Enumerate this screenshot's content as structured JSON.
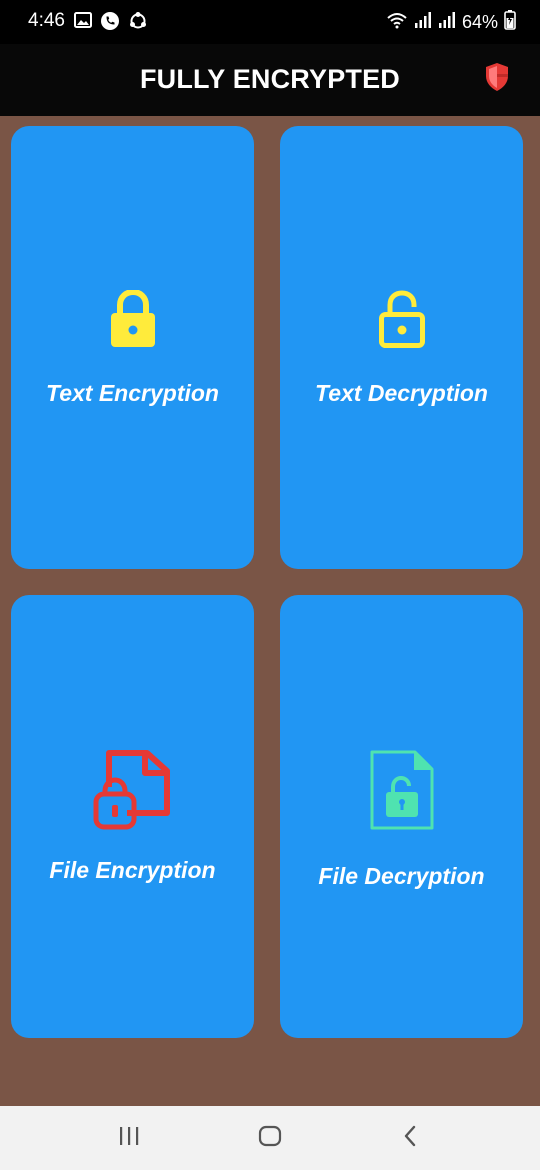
{
  "status_bar": {
    "time": "4:46",
    "battery": "64%",
    "left_icons": [
      "image-icon",
      "phone-icon",
      "sync-icon"
    ],
    "right_icons": [
      "wifi-icon",
      "signal-icon",
      "signal-icon",
      "battery-charging-icon"
    ]
  },
  "app_bar": {
    "title": "FULLY ENCRYPTED",
    "action_icon": "shield-icon"
  },
  "cards": [
    {
      "label": "Text Encryption",
      "icon": "lock-closed-icon",
      "icon_color": "#ffeb3b"
    },
    {
      "label": "Text Decryption",
      "icon": "lock-open-icon",
      "icon_color": "#ffeb3b"
    },
    {
      "label": "File Encryption",
      "icon": "file-lock-icon",
      "icon_color": "#e53935"
    },
    {
      "label": "File Decryption",
      "icon": "file-unlock-icon",
      "icon_color": "#4fe3b0"
    }
  ],
  "nav_bar": {
    "buttons": [
      "recent-apps-icon",
      "home-icon",
      "back-icon"
    ]
  },
  "colors": {
    "background": "#7a5546",
    "card": "#2196f3",
    "app_bar": "#080808",
    "nav_bar": "#f2f2f2",
    "shield_red": "#e53935"
  }
}
